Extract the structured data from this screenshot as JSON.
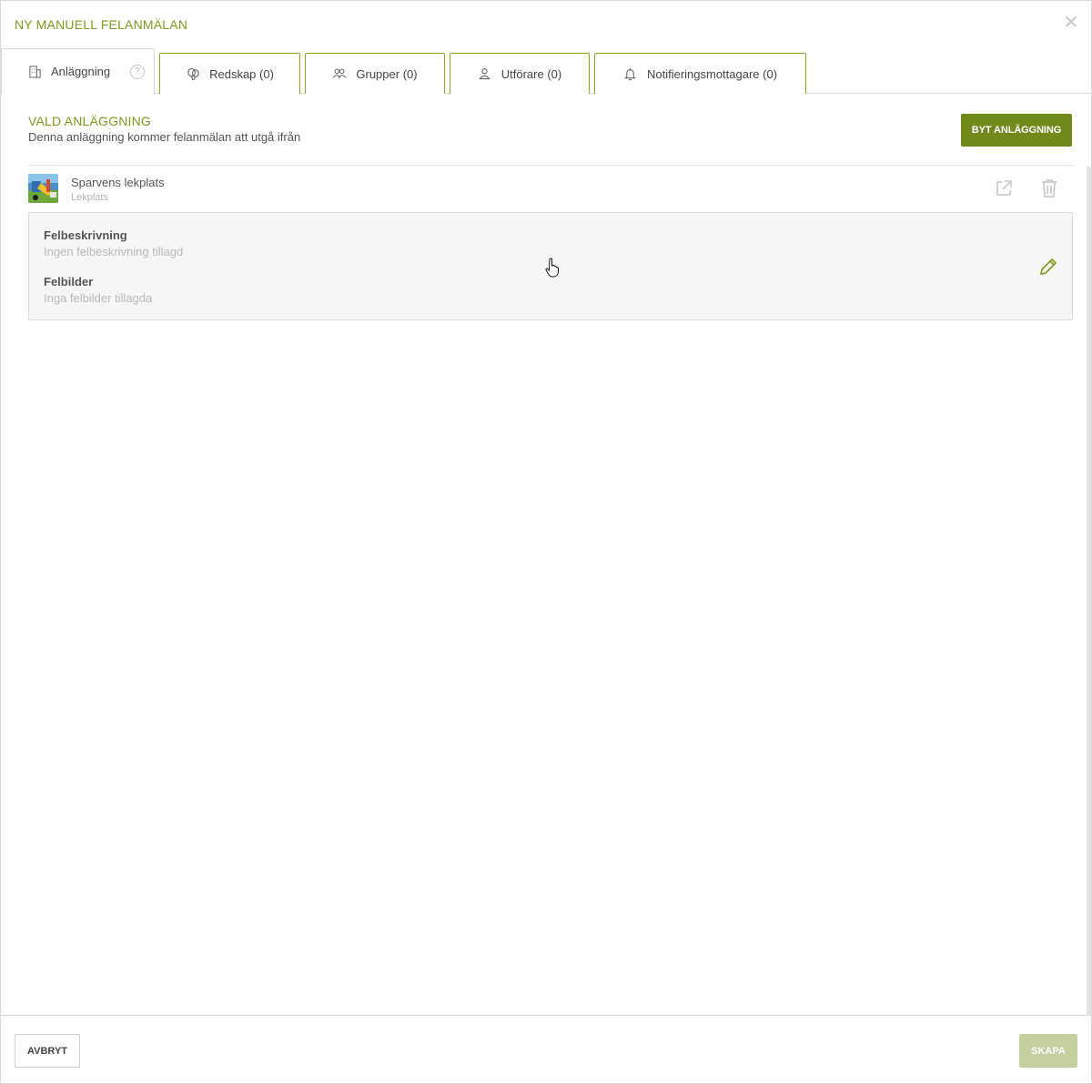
{
  "modal": {
    "title": "NY MANUELL FELANMÄLAN",
    "close_icon": "close-icon"
  },
  "tabs": [
    {
      "label": "Anläggning",
      "icon": "building-icon",
      "active": true,
      "help_icon": "question-circle-icon"
    },
    {
      "label": "Redskap (0)",
      "icon": "balloons-icon",
      "active": false
    },
    {
      "label": "Grupper (0)",
      "icon": "group-icon",
      "active": false
    },
    {
      "label": "Utförare (0)",
      "icon": "user-icon",
      "active": false
    },
    {
      "label": "Notifieringsmottagare (0)",
      "icon": "bell-icon",
      "active": false
    }
  ],
  "section": {
    "title": "VALD ANLÄGGNING",
    "subtitle": "Denna anläggning kommer felanmälan att utgå ifrån",
    "change_button": "BYT ANLÄGGNING"
  },
  "facility": {
    "name": "Sparvens lekplats",
    "type": "Lekplats",
    "actions": [
      "external-link-icon",
      "trash-icon"
    ]
  },
  "details": {
    "description_label": "Felbeskrivning",
    "description_value": "Ingen felbeskrivning tillagd",
    "images_label": "Felbilder",
    "images_value": "Inga felbilder tillagda",
    "edit_icon": "pencil-icon"
  },
  "footer": {
    "cancel": "AVBRYT",
    "create": "SKAPA"
  },
  "colors": {
    "accent": "#7a9a1e",
    "primary_button": "#71891b",
    "disabled_button": "#c4d0a0",
    "tab_border": "#8aa62a"
  }
}
